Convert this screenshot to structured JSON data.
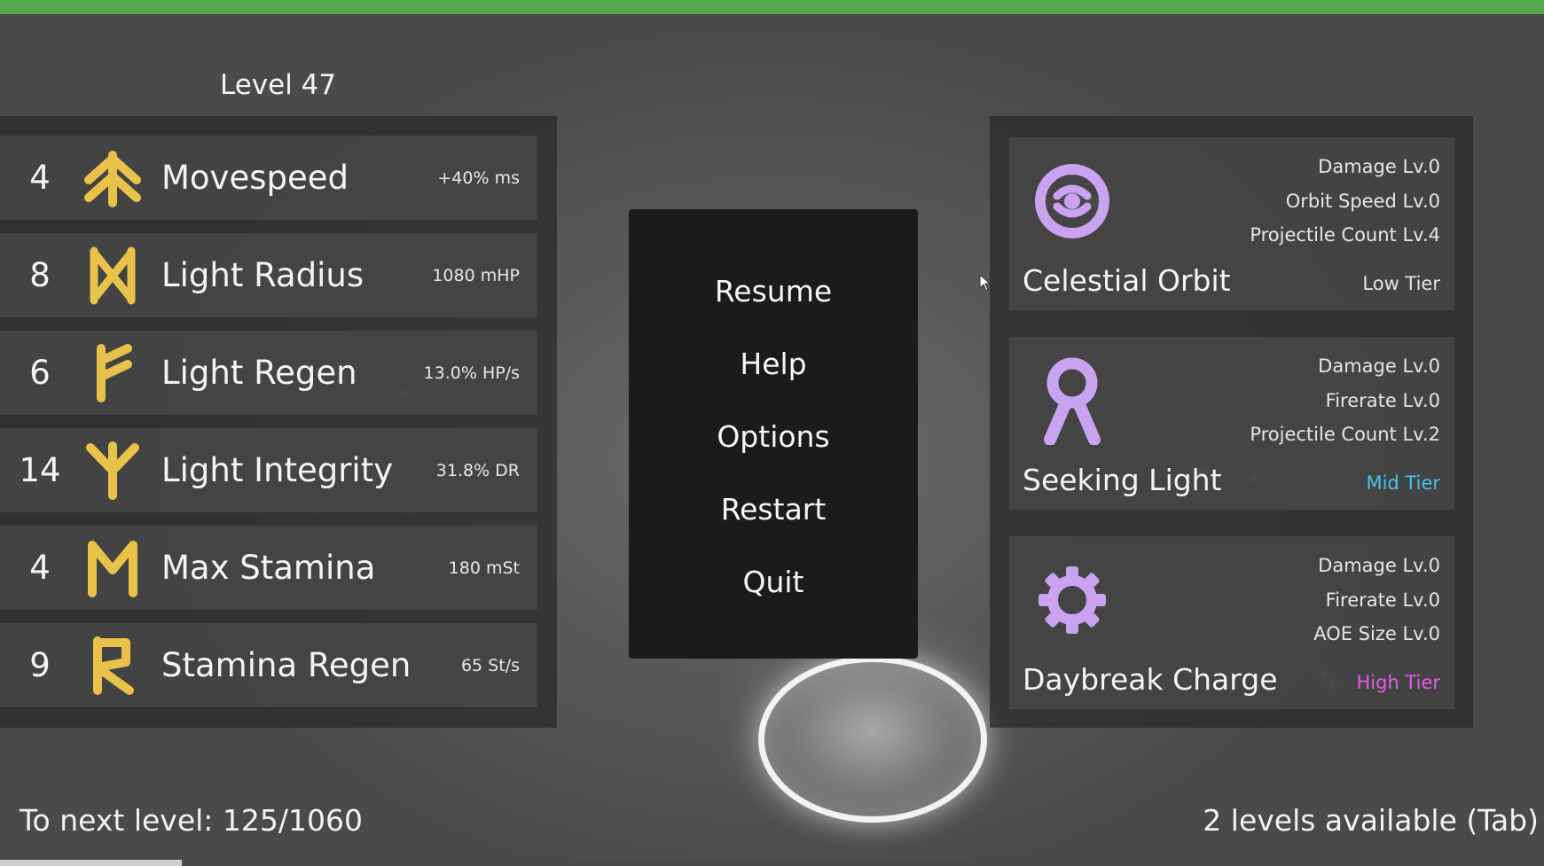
{
  "hud": {
    "level_title": "Level 47",
    "next_level_text": "To next level: 125/1060",
    "xp_current": 125,
    "xp_required": 1060,
    "levels_available_text": "2 levels available (Tab)"
  },
  "stats": [
    {
      "level": "4",
      "name": "Movespeed",
      "value": "+40% ms",
      "icon": "chevron-arrow-up-rune-icon"
    },
    {
      "level": "8",
      "name": "Light Radius",
      "value": "1080 mHP",
      "icon": "hourglass-rune-icon"
    },
    {
      "level": "6",
      "name": "Light Regen",
      "value": "13.0% HP/s",
      "icon": "fehu-rune-icon"
    },
    {
      "level": "14",
      "name": "Light Integrity",
      "value": "31.8% DR",
      "icon": "algiz-rune-icon"
    },
    {
      "level": "4",
      "name": "Max Stamina",
      "value": "180 mSt",
      "icon": "m-rune-icon"
    },
    {
      "level": "9",
      "name": "Stamina Regen",
      "value": "65 St/s",
      "icon": "raido-rune-icon"
    }
  ],
  "pause_menu": {
    "items": [
      "Resume",
      "Help",
      "Options",
      "Restart",
      "Quit"
    ]
  },
  "weapons": [
    {
      "name": "Celestial Orbit",
      "upgrades": [
        "Damage Lv.0",
        "Orbit Speed Lv.0",
        "Projectile Count Lv.4"
      ],
      "tier": "Low Tier",
      "tier_color": "#e6e6e6",
      "icon": "orbit-icon"
    },
    {
      "name": "Seeking Light",
      "upgrades": [
        "Damage Lv.0",
        "Firerate Lv.0",
        "Projectile Count Lv.2"
      ],
      "tier": "Mid Tier",
      "tier_color": "#48c4ec",
      "icon": "ankh-ribbon-icon"
    },
    {
      "name": "Daybreak Charge",
      "upgrades": [
        "Damage Lv.0",
        "Firerate Lv.0",
        "AOE Size Lv.0"
      ],
      "tier": "High Tier",
      "tier_color": "#e05ce8",
      "icon": "sun-gear-icon"
    }
  ],
  "colors": {
    "rune_gold": "#e9c349",
    "weapon_lavender": "#c9a3f0",
    "top_bar_green": "#56a84d"
  }
}
